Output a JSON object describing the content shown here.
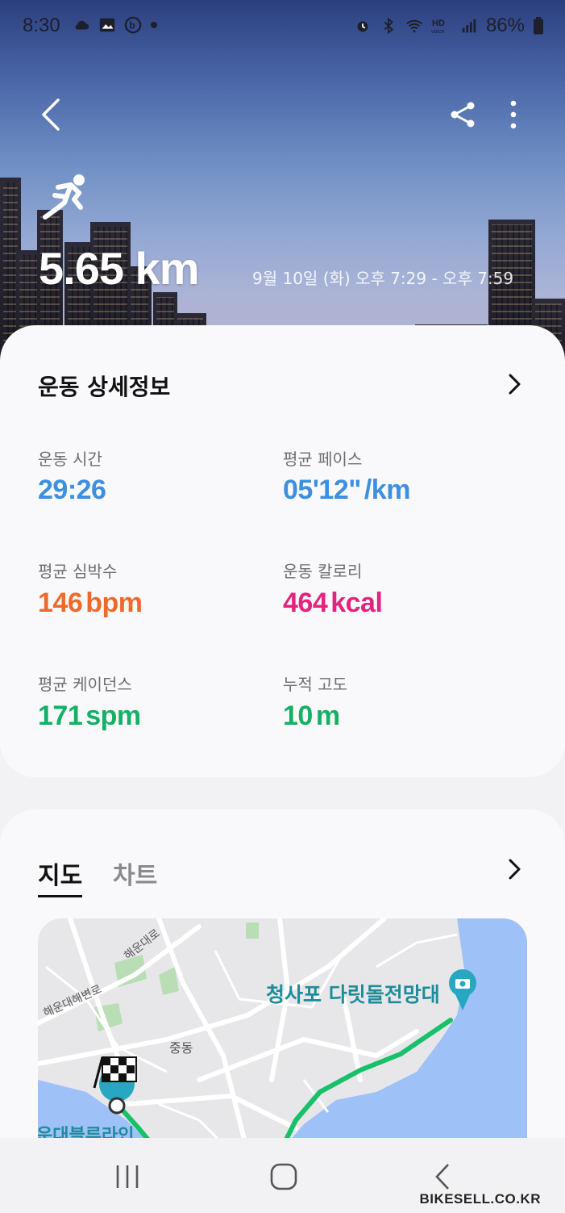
{
  "status": {
    "time": "8:30",
    "battery": "86%"
  },
  "hero": {
    "distance": "5.65 km",
    "date_range": "9월 10일 (화) 오후 7:29 - 오후 7:59"
  },
  "details": {
    "title": "운동 상세정보",
    "stats": [
      {
        "label": "운동 시간",
        "value": "29:26",
        "unit": "",
        "color": "#3d8fe0"
      },
      {
        "label": "평균 페이스",
        "value": "05'12\"",
        "unit": "/km",
        "color": "#3d8fe0"
      },
      {
        "label": "평균 심박수",
        "value": "146",
        "unit": "bpm",
        "color": "#ee6a2a"
      },
      {
        "label": "운동 칼로리",
        "value": "464",
        "unit": "kcal",
        "color": "#e3247e"
      },
      {
        "label": "평균 케이던스",
        "value": "171",
        "unit": "spm",
        "color": "#13b065"
      },
      {
        "label": "누적 고도",
        "value": "10",
        "unit": "m",
        "color": "#13b065"
      }
    ]
  },
  "map_section": {
    "tabs": [
      "지도",
      "차트"
    ],
    "map_labels": [
      "해운대로",
      "해운대해변로",
      "중동"
    ],
    "poi": "청사포 다릿돌전망대",
    "bottom_label": "운대블루라인"
  },
  "watermark": "BIKESELL.CO.KR",
  "colors": {
    "route": "#18c06a",
    "sea": "#9ec1f7",
    "accent_blue": "#3d8fe0"
  }
}
